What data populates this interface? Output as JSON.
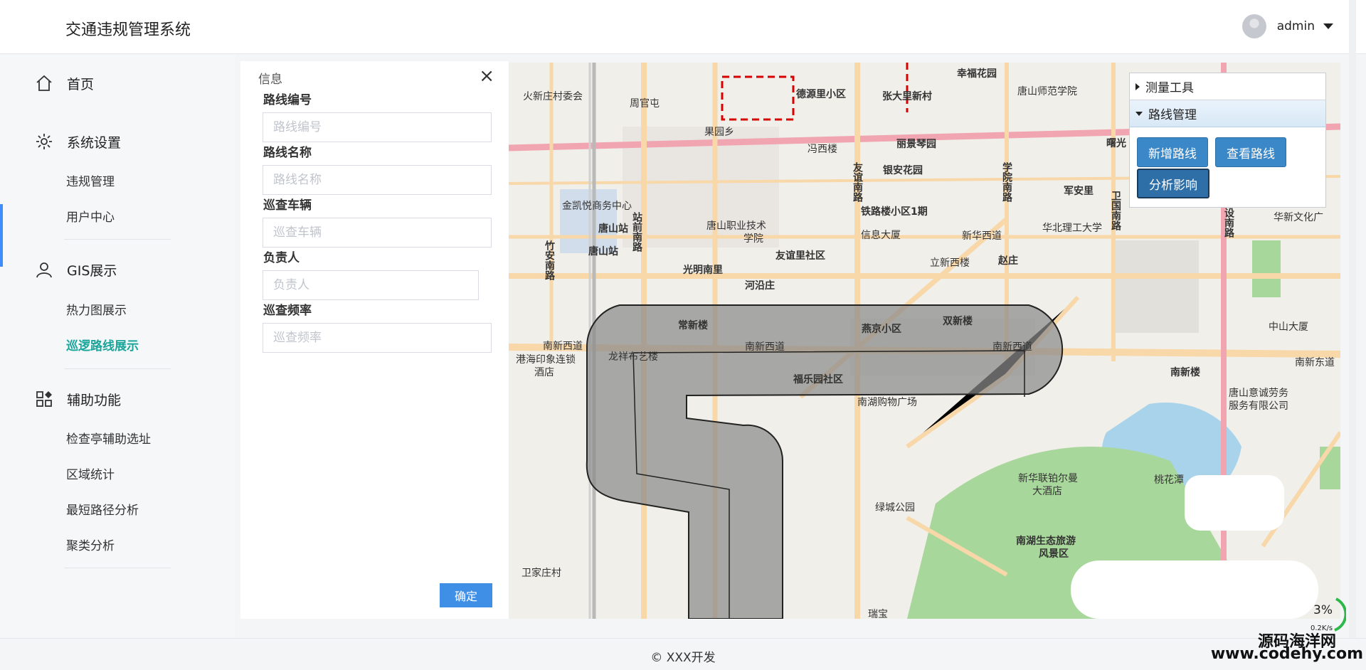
{
  "header": {
    "app_title": "交通违规管理系统",
    "user_name": "admin"
  },
  "sidebar": {
    "home": "首页",
    "system_settings": "系统设置",
    "system_items": [
      "违规管理",
      "用户中心"
    ],
    "gis": "GIS展示",
    "gis_items": [
      "热力图展示",
      "巡逻路线展示"
    ],
    "aux": "辅助功能",
    "aux_items": [
      "检查亭辅助选址",
      "区域统计",
      "最短路径分析",
      "聚类分析"
    ]
  },
  "form": {
    "title": "信息",
    "fields": [
      {
        "label": "路线编号",
        "placeholder": "路线编号"
      },
      {
        "label": "路线名称",
        "placeholder": "路线名称"
      },
      {
        "label": "巡查车辆",
        "placeholder": "巡查车辆"
      },
      {
        "label": "负责人",
        "placeholder": "负责人"
      },
      {
        "label": "巡查频率",
        "placeholder": "巡查频率"
      }
    ],
    "confirm_label": "确定"
  },
  "tools": {
    "measure": "测量工具",
    "route_mgmt": "路线管理",
    "add_route": "新增路线",
    "view_route": "查看路线",
    "analyze": "分析影响"
  },
  "map": {
    "labels": [
      "德源里小区",
      "张大里新村",
      "幸福花园",
      "唐山师范学院",
      "周官屯",
      "果园乡",
      "冯西楼",
      "丽景琴园",
      "银安花园",
      "曙光",
      "军安里",
      "卫国南路",
      "金凯悦商务中心",
      "唐山站",
      "唐山职业技术学院",
      "铁路楼小区1期",
      "华北理工大学",
      "华新文化广",
      "信息大厦",
      "新华西道",
      "竹安南路",
      "站前南路",
      "光明南里",
      "友谊里社区",
      "立新西楼",
      "赵庄",
      "河沿庄",
      "常新楼",
      "燕京小区",
      "双新楼",
      "中山大厦",
      "南新西道",
      "港海印象连锁酒店",
      "龙祥布艺楼",
      "福乐园社区",
      "南新东道",
      "南新楼",
      "唐山意诚劳务服务有限公司",
      "南湖购物广场",
      "友谊南路",
      "新华联铂尔曼大酒店",
      "桃花潭",
      "绿城公园",
      "南湖生态旅游风景区",
      "卫家庄村",
      "瑞宝",
      "友谊南路",
      "学院南路",
      "建设南路",
      "火新庄村委会"
    ],
    "speed_value": "3%",
    "speed_rate": "0.2K/s"
  },
  "footer": {
    "copyright": "© XXX开发"
  },
  "watermark": {
    "line1": "源码海洋网",
    "line2": "www.codehy.com"
  },
  "colors": {
    "accent": "#3f8cff",
    "active_menu": "#18a59a",
    "tool_button": "#3b88c8",
    "route_fill": "#8a8a8a"
  }
}
